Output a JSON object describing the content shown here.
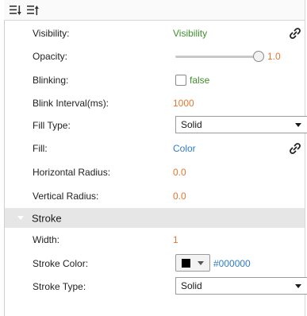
{
  "toolbar": {
    "sort_categorized_icon": "sort-categorized-icon",
    "sort_alphabetical_icon": "sort-alphabetical-icon"
  },
  "colors": {
    "value_orange": "#e0772e",
    "value_green": "#3f8f2a",
    "value_blue": "#2f7cc6",
    "section_bg": "#e6e6e6"
  },
  "properties": {
    "visibility": {
      "label": "Visibility:",
      "value": "Visibility"
    },
    "opacity": {
      "label": "Opacity:",
      "value": "1.0",
      "fraction": 1.0
    },
    "blinking": {
      "label": "Blinking:",
      "value": "false",
      "checked": false
    },
    "blink_interval": {
      "label": "Blink Interval(ms):",
      "value": "1000"
    },
    "fill_type": {
      "label": "Fill Type:",
      "value": "Solid"
    },
    "fill": {
      "label": "Fill:",
      "value": "Color"
    },
    "horizontal_radius": {
      "label": "Horizontal Radius:",
      "value": "0.0"
    },
    "vertical_radius": {
      "label": "Vertical Radius:",
      "value": "0.0"
    }
  },
  "stroke": {
    "title": "Stroke",
    "width": {
      "label": "Width:",
      "value": "1"
    },
    "color": {
      "label": "Stroke Color:",
      "value": "#000000",
      "swatch": "#000000"
    },
    "type": {
      "label": "Stroke Type:",
      "value": "Solid"
    }
  }
}
